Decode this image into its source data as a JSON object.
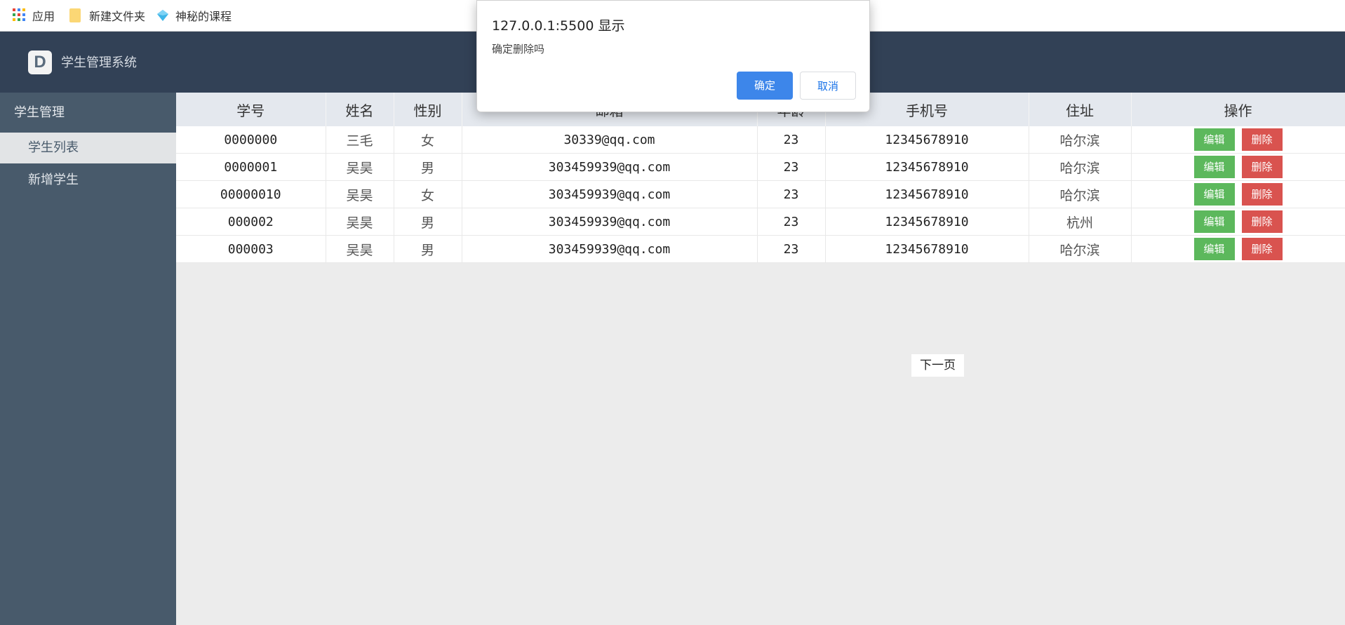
{
  "bookmarks": {
    "apps": "应用",
    "folder": "新建文件夹",
    "course": "神秘的课程"
  },
  "header": {
    "logo_letter": "D",
    "title": "学生管理系统"
  },
  "sidebar": {
    "group": "学生管理",
    "items": [
      {
        "label": "学生列表"
      },
      {
        "label": "新增学生"
      }
    ]
  },
  "table": {
    "columns": [
      "学号",
      "姓名",
      "性别",
      "邮箱",
      "年龄",
      "手机号",
      "住址",
      "操作"
    ],
    "rows": [
      {
        "id": "0000000",
        "name": "三毛",
        "gender": "女",
        "email": "30339@qq.com",
        "age": "23",
        "phone": "12345678910",
        "address": "哈尔滨"
      },
      {
        "id": "0000001",
        "name": "吴昊",
        "gender": "男",
        "email": "303459939@qq.com",
        "age": "23",
        "phone": "12345678910",
        "address": "哈尔滨"
      },
      {
        "id": "00000010",
        "name": "吴昊",
        "gender": "女",
        "email": "303459939@qq.com",
        "age": "23",
        "phone": "12345678910",
        "address": "哈尔滨"
      },
      {
        "id": "000002",
        "name": "吴昊",
        "gender": "男",
        "email": "303459939@qq.com",
        "age": "23",
        "phone": "12345678910",
        "address": "杭州"
      },
      {
        "id": "000003",
        "name": "吴昊",
        "gender": "男",
        "email": "303459939@qq.com",
        "age": "23",
        "phone": "12345678910",
        "address": "哈尔滨"
      }
    ],
    "edit_label": "编辑",
    "delete_label": "删除"
  },
  "pagination": {
    "next_label": "下一页"
  },
  "dialog": {
    "title": "127.0.0.1:5500 显示",
    "message": "确定删除吗",
    "ok_label": "确定",
    "cancel_label": "取消"
  },
  "colors": {
    "header_bg": "#324156",
    "sidebar_bg": "#485a6b",
    "edit_button": "#5cb85c",
    "delete_button": "#d9534f",
    "dialog_ok": "#3d86ea"
  }
}
